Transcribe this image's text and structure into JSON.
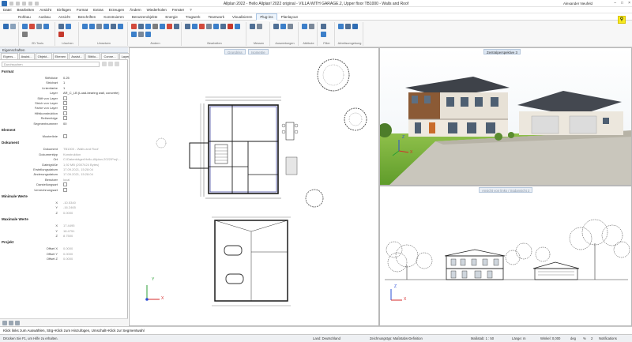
{
  "window": {
    "title": "Allplan 2022 - Hello Allplan! 2022 original - VILLA WITH GARAGE.2, Upper floor TB1000 - Walls and Roof",
    "user": "Alexander Neufeld",
    "controls": [
      "–",
      "□",
      "×"
    ]
  },
  "menu": [
    "Datei",
    "Bearbeiten",
    "Ansicht",
    "Einfügen",
    "Format",
    "Extras",
    "Erzeugen",
    "Ändern",
    "Wiederholen",
    "Fenster",
    "?"
  ],
  "ribbon_tabs": [
    {
      "label": "Rohbau",
      "active": false
    },
    {
      "label": "Ausbau",
      "active": false
    },
    {
      "label": "Ansicht",
      "active": false
    },
    {
      "label": "Beschriften",
      "active": false
    },
    {
      "label": "Konstruieren",
      "active": false
    },
    {
      "label": "Benutzerobjekte",
      "active": false
    },
    {
      "label": "Energie",
      "active": false
    },
    {
      "label": "Tragwerk",
      "active": false
    },
    {
      "label": "Teamwork",
      "active": false
    },
    {
      "label": "Visualisieren",
      "active": false
    },
    {
      "label": "Plug-ins",
      "active": true
    },
    {
      "label": "Planlayout",
      "active": false
    }
  ],
  "ribbon_groups": [
    {
      "label": "",
      "icons": [
        "#2f6db4",
        "#8aa2bb"
      ]
    },
    {
      "label": "2D-Tools",
      "icons": [
        "#3c7fc9",
        "#d24a3c",
        "#6c8aa8",
        "#3c7fc9",
        "#7d7d7d"
      ]
    },
    {
      "label": "Löschen",
      "icons": [
        "#4f6f95",
        "#3c7fc9",
        "#c6392d"
      ]
    },
    {
      "label": "Umsetzen",
      "icons": [
        "#3c7fc9",
        "#3c7fc9",
        "#7a8899",
        "#3c7fc9",
        "#4f6f95",
        "#3c7fc9"
      ]
    },
    {
      "label": "Ändern",
      "icons": [
        "#d24a3c",
        "#4f6f95",
        "#3c7fc9",
        "#7d7d7d",
        "#3c7fc9",
        "#d24a3c",
        "#4f6f95",
        "#3c7fc9",
        "#7a8899",
        "#3c7fc9"
      ]
    },
    {
      "label": "Bearbeiten",
      "icons": [
        "#4f6f95",
        "#3c7fc9",
        "#d24a3c",
        "#7a8899",
        "#3c7fc9",
        "#4f6f95",
        "#c6392d",
        "#3c7fc9"
      ]
    },
    {
      "label": "Messen",
      "icons": [
        "#4f6f95",
        "#7a8899"
      ]
    },
    {
      "label": "Auswertungen",
      "icons": [
        "#4f6f95",
        "#3c7fc9",
        "#7a8899"
      ]
    },
    {
      "label": "Attribute",
      "icons": [
        "#3c7fc9",
        "#7a8899"
      ]
    },
    {
      "label": "Filter",
      "icons": [
        "#4f6f95",
        "#3c7fc9"
      ]
    },
    {
      "label": "Arbeitsumgebung",
      "icons": [
        "#3c7fc9",
        "#4f6f95",
        "#2f6db4"
      ]
    }
  ],
  "help_button": "⚲",
  "properties": {
    "title": "Eigenschaften",
    "tabs": [
      "Eigens...",
      "Assist...",
      "Objekt...",
      "Ebenen",
      "Assist...",
      "Biblio...",
      "Conne...",
      "Layer"
    ],
    "search_placeholder": "Durchsuchen",
    "format_section": "Format",
    "format_rows": [
      {
        "label": "Stiftdicke",
        "value": "0.25"
      },
      {
        "label": "Strichart",
        "value": "1"
      },
      {
        "label": "Linienfarbe",
        "value": "1"
      },
      {
        "label": "Layer",
        "value": "AR_C_LB (Load-bearing wall, concrete)"
      },
      {
        "label": "Stift von Layer",
        "value": ""
      },
      {
        "label": "Strich von Layer",
        "value": ""
      },
      {
        "label": "Farbe von Layer",
        "value": ""
      },
      {
        "label": "Hilfskonstruktion",
        "value": ""
      },
      {
        "label": "Reihenfolge",
        "value": ""
      },
      {
        "label": "Segmentnummer",
        "value": "00"
      }
    ],
    "element_section": "Element",
    "element_rows": [
      {
        "label": "Musterlinie",
        "value": ""
      }
    ],
    "document_section": "Dokument",
    "document_rows": [
      {
        "label": "Dokument",
        "value": "TB1000 - Walls and Roof"
      },
      {
        "label": "Dokumenttyp",
        "value": "Konstruktion"
      },
      {
        "label": "Ort",
        "value": "C:\\Datenträger\\Hello-Allplan-2022\\Proj\\..."
      },
      {
        "label": "Dateigröße",
        "value": "1,92 MB (2007424 Bytes)"
      },
      {
        "label": "Erstellungsdatum",
        "value": "17.09.2021, 15:28:04"
      },
      {
        "label": "Änderungsdatum",
        "value": "17.09.2021, 15:28:04"
      },
      {
        "label": "Benutzer",
        "value": "local"
      },
      {
        "label": "Darstellungsart",
        "value": ""
      },
      {
        "label": "Umrechnungsart",
        "value": ""
      }
    ],
    "min_section": "Minimale Werte",
    "min_rows": [
      {
        "label": "X",
        "value": "-10.5340"
      },
      {
        "label": "Y",
        "value": "-16.2465"
      },
      {
        "label": "Z",
        "value": "0.0000"
      }
    ],
    "max_section": "Maximale Werte",
    "max_rows": [
      {
        "label": "X",
        "value": "17.4495"
      },
      {
        "label": "Y",
        "value": "18.4751"
      },
      {
        "label": "Z",
        "value": "8.7500"
      }
    ],
    "project_section": "Projekt",
    "project_rows": [
      {
        "label": "Offset X",
        "value": "0.0000"
      },
      {
        "label": "Offset Y",
        "value": "0.0000"
      },
      {
        "label": "Offset Z",
        "value": "0.0000"
      }
    ]
  },
  "viewports": {
    "plan_label": "Grundriss",
    "plan_label2": "Isometrie",
    "persp_label": "Zentralperspektive 3",
    "elev_label": "Ansicht von links / Südansicht 2"
  },
  "axis": {
    "x": "X",
    "y": "Y",
    "z": "Z"
  },
  "hint": "Klick links zum Auswählen, Strg+Klick zum Hinzufügen, Umschalt+Klick zur Segmentwahl",
  "status": {
    "help": "Drücken Sie F1, um Hilfe zu erhalten.",
    "land": "Land: Deutschland",
    "zeichnungstyp": "Zeichnungstyp: Maßstabs-Definition",
    "massstab": "Maßstab: 1 : 50",
    "laenge": "Länge: m",
    "winkel": "Winkel: 0,000",
    "grad": "deg",
    "prozent": "%",
    "zoom": "2",
    "notifications": "Notifications"
  }
}
